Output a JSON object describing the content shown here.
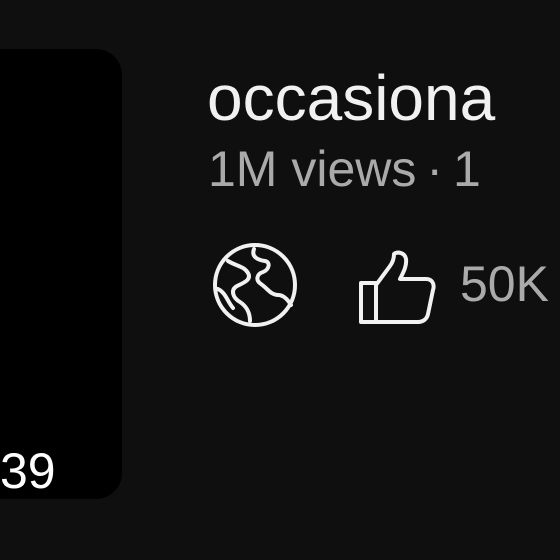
{
  "video": {
    "duration": "39",
    "title": "occasiona",
    "views": "1M views",
    "separator": "·",
    "age_fragment": "1",
    "like_count": "50K"
  },
  "icons": {
    "visibility": "globe-icon",
    "like": "thumbs-up-icon"
  },
  "colors": {
    "background": "#0f0f0f",
    "thumbnail": "#000000",
    "title_text": "#f1f1f1",
    "meta_text": "#aaaaaa",
    "icon_stroke": "#f1f1f1"
  }
}
